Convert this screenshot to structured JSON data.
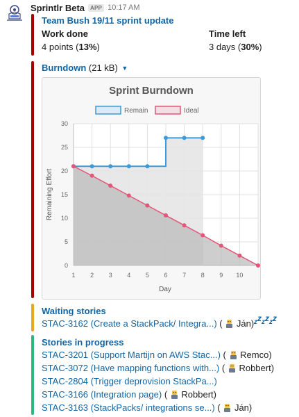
{
  "message": {
    "bot_name": "Sprintlr Beta",
    "badge": "APP",
    "time": "10:17 AM"
  },
  "update": {
    "title": "Team Bush 19/11 sprint update",
    "work_done_label": "Work done",
    "work_done_value": "4 points",
    "work_done_pct": "13%",
    "time_left_label": "Time left",
    "time_left_value": "3 days",
    "time_left_pct": "30%",
    "bar_color": "#a30200"
  },
  "attachment": {
    "name": "Burndown",
    "size": "(21 kB)",
    "bar_color": "#a30200"
  },
  "chart_data": {
    "type": "line",
    "title": "Sprint Burndown",
    "xlabel": "Day",
    "ylabel": "Remaining Effort",
    "ylim": [
      0,
      30
    ],
    "xlim": [
      1,
      11
    ],
    "x_ticks": [
      "1",
      "2",
      "3",
      "4",
      "5",
      "6",
      "7",
      "8",
      "9",
      "10"
    ],
    "y_ticks": [
      "0",
      "5",
      "10",
      "15",
      "20",
      "25",
      "30"
    ],
    "grid": true,
    "legend_position": "top",
    "series": [
      {
        "name": "Remain",
        "color": "#3b9ad9",
        "points": [
          [
            1,
            21
          ],
          [
            2,
            21
          ],
          [
            3,
            21
          ],
          [
            4,
            21
          ],
          [
            5,
            21
          ],
          [
            6,
            27
          ],
          [
            7,
            27
          ],
          [
            8,
            27
          ]
        ],
        "step": "after",
        "fill": "#e6e6e6"
      },
      {
        "name": "Ideal",
        "color": "#e4557a",
        "points": [
          [
            1,
            21
          ],
          [
            2,
            19
          ],
          [
            3,
            16.9
          ],
          [
            4,
            14.8
          ],
          [
            5,
            12.7
          ],
          [
            6,
            10.6
          ],
          [
            7,
            8.5
          ],
          [
            8,
            6.4
          ],
          [
            9,
            4.2
          ],
          [
            10,
            2.1
          ],
          [
            11,
            0
          ]
        ],
        "fill": "#b9b9b9"
      }
    ]
  },
  "waiting": {
    "title": "Waiting stories",
    "bar_color": "#e8a723",
    "items": [
      {
        "story": "STAC-3162 (Create a StackPack/ Integra...)",
        "owner": "Ján"
      }
    ],
    "sleep": "zzzzzz"
  },
  "in_progress": {
    "title": "Stories in progress",
    "bar_color": "#2eb67d",
    "items": [
      {
        "story": "STAC-3201 (Support Martijn on AWS Stac...)",
        "owner": "Remco"
      },
      {
        "story": "STAC-3072 (Have mapping functions with...)",
        "owner": "Robbert"
      },
      {
        "story": "STAC-2804 (Trigger deprovision StackPa...)",
        "owner": ""
      },
      {
        "story": "STAC-3166 (Integration page)",
        "owner": "Robbert"
      },
      {
        "story": "STAC-3163 (StackPacks/ integrations se...)",
        "owner": "Ján"
      }
    ]
  }
}
